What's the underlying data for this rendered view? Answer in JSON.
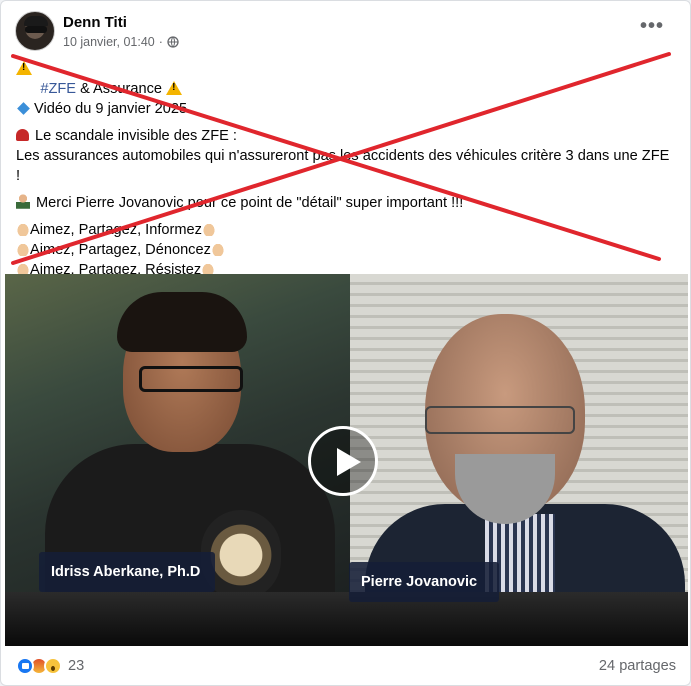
{
  "post": {
    "author": "Denn Titi",
    "date": "10 janvier, 01:40",
    "privacy_icon": "globe-icon",
    "more_label": "•••"
  },
  "text": {
    "line1_hashtag": "#ZFE",
    "line1_rest": " & Assurance ",
    "line2": "Vidéo du 9 janvier 2025",
    "line3": "Le scandale invisible des ZFE :",
    "line4": "Les assurances automobiles qui n'assureront pas les accidents des véhicules critère 3 dans une ZFE !",
    "line5": "Merci Pierre Jovanovic pour ce point de \"détail\" super important !!!",
    "line6": "Aimez, Partagez, Informez",
    "line7": "Aimez, Partagez, Dénoncez",
    "line8": "Aimez, Partagez, Résistez"
  },
  "video": {
    "left_name": "Idriss Aberkane, Ph.D",
    "right_name": "Pierre Jovanovic",
    "play_icon": "play-icon"
  },
  "footer": {
    "reaction_count": "23",
    "shares": "24 partages"
  },
  "colors": {
    "cross": "#e0262d",
    "hashtag": "#385898",
    "meta": "#65676b"
  }
}
